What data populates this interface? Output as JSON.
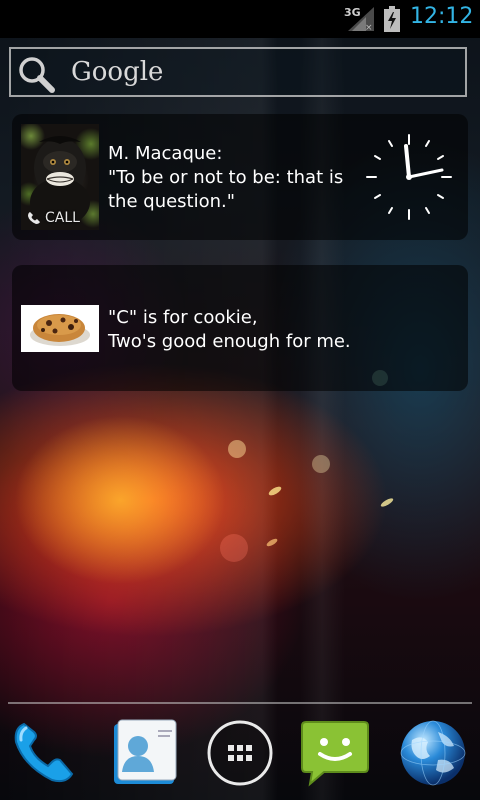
{
  "status_bar": {
    "network_type": "3G",
    "time": "12:12",
    "accent_color": "#33b5e5",
    "icons": [
      "signal-icon",
      "battery-charging-icon"
    ]
  },
  "search": {
    "label": "Google",
    "icon": "search-icon"
  },
  "contact_widget": {
    "name": "M. Macaque:",
    "quote_line1": "\"To be or not to be: that is",
    "quote_line2": "the question.\"",
    "call_label": "CALL",
    "icons": [
      "contact-photo",
      "phone-handset-icon",
      "analog-clock-icon"
    ],
    "clock": {
      "hour": 12,
      "minute": 12
    }
  },
  "cookie_widget": {
    "line1": "\"C\" is for cookie,",
    "line2": "Two's good enough for me.",
    "icons": [
      "cookie-image"
    ]
  },
  "dock": {
    "items": [
      "phone-icon",
      "contacts-icon",
      "app-drawer-icon",
      "messaging-icon",
      "browser-icon"
    ]
  }
}
